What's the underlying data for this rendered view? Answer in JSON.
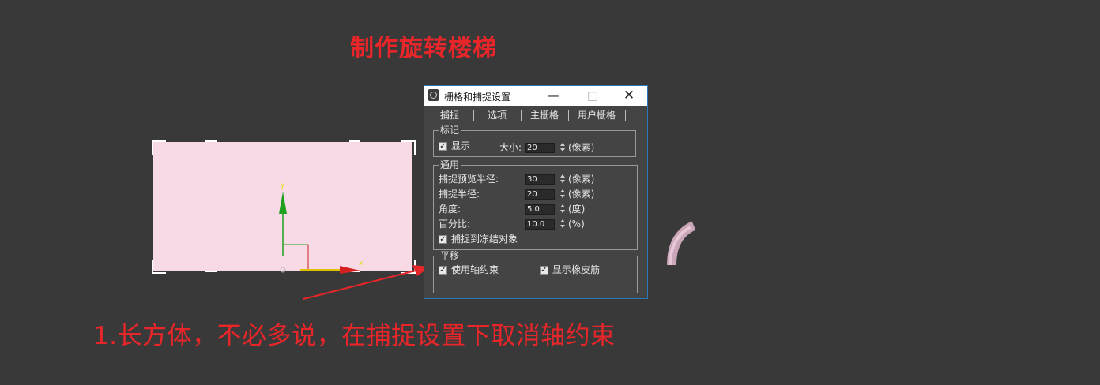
{
  "annotations": {
    "title": "制作旋转楼梯",
    "step1": "1.长方体，不必多说，在捕捉设置下取消轴约束"
  },
  "viewport": {
    "axis_y_label": "y",
    "axis_x_label": "x"
  },
  "colors": {
    "annotation_red": "#e8262a",
    "viewport_bg": "#393939",
    "box_fill": "#f8d9e6",
    "dialog_bg": "#444444",
    "axis_y": "#1fa01f",
    "axis_x": "#d42020"
  },
  "dialog": {
    "title": "栅格和捕捉设置",
    "icon": "3dsmax-app-icon",
    "tabs": [
      "捕捉",
      "选项",
      "主栅格",
      "用户栅格"
    ],
    "marks": {
      "legend": "标记",
      "show_label": "显示",
      "show_checked": true,
      "size_label": "大小:",
      "size_value": "20",
      "size_unit": "(像素)"
    },
    "general": {
      "legend": "通用",
      "preview_radius_label": "捕捉预览半径:",
      "preview_radius_value": "30",
      "preview_radius_unit": "(像素)",
      "snap_radius_label": "捕捉半径:",
      "snap_radius_value": "20",
      "snap_radius_unit": "(像素)",
      "angle_label": "角度:",
      "angle_value": "5.0",
      "angle_unit": "(度)",
      "percent_label": "百分比:",
      "percent_value": "10.0",
      "percent_unit": "(%)",
      "snap_frozen_label": "捕捉到冻结对象",
      "snap_frozen_checked": true
    },
    "translation": {
      "legend": "平移",
      "use_axis_label": "使用轴约束",
      "use_axis_checked": true,
      "rubber_band_label": "显示橡皮筋",
      "rubber_band_checked": true
    }
  }
}
